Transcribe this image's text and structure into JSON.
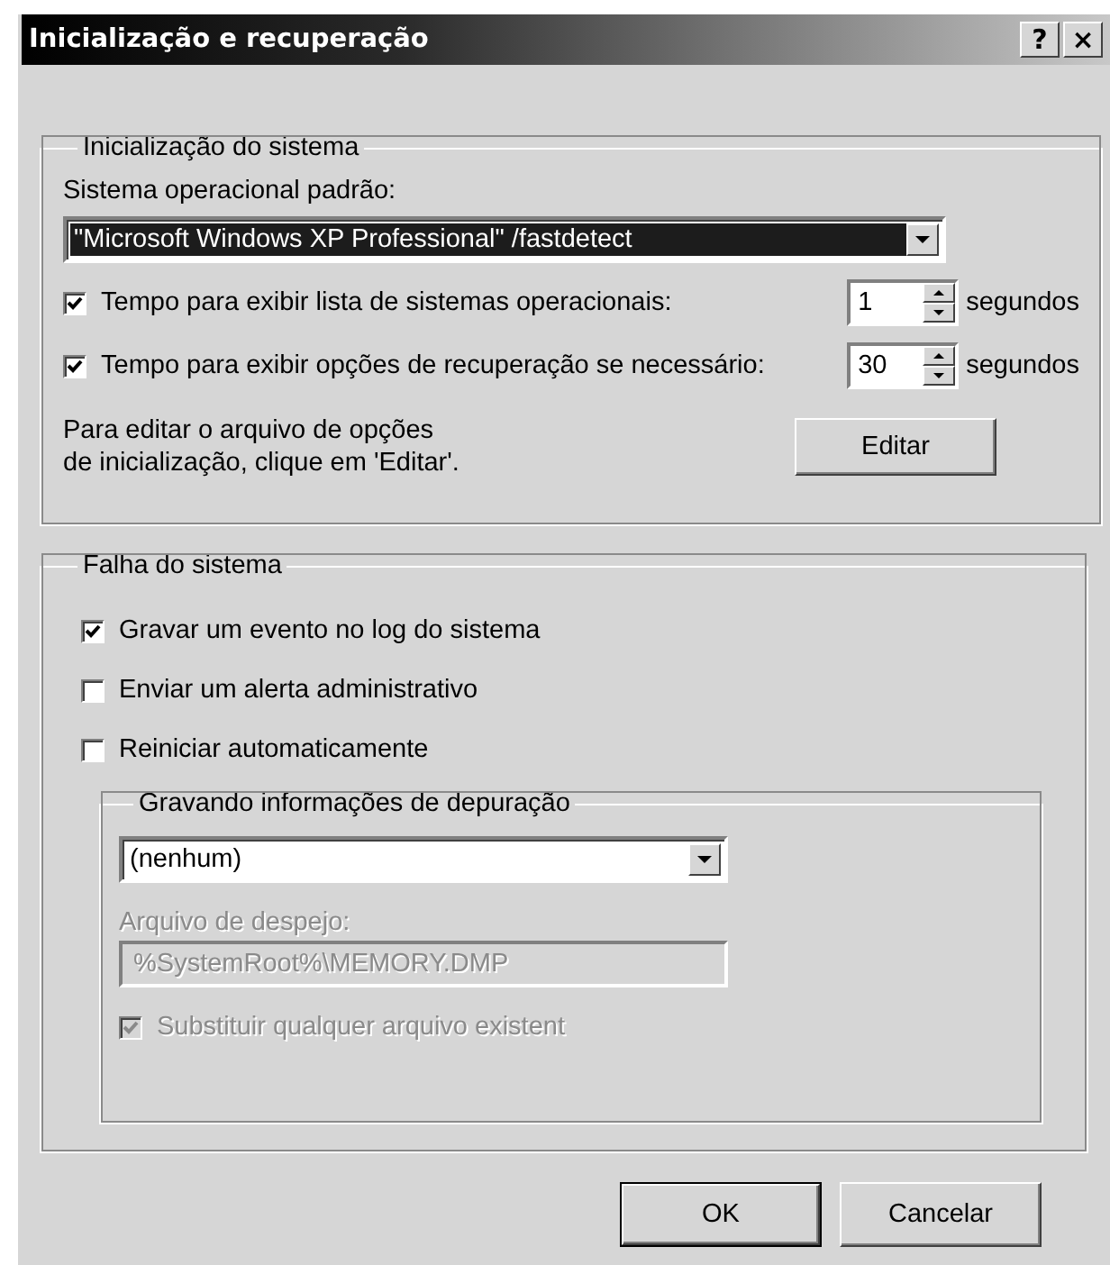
{
  "window": {
    "title": "Inicialização e recuperação",
    "help_button": "?",
    "close_button": "×"
  },
  "startup": {
    "legend": "Inicialização do sistema",
    "os_label": "Sistema operacional padrão:",
    "os_select": {
      "value": "\"Microsoft Windows XP Professional\" /fastdetect",
      "highlighted": true
    },
    "timeouts": [
      {
        "label": "Tempo para exibir lista de sistemas operacionais:",
        "checked": true,
        "value": "1",
        "unit": "segundos"
      },
      {
        "label": "Tempo para exibir opções de recuperação se necessário:",
        "checked": true,
        "value": "30",
        "unit": "segundos"
      }
    ],
    "edit_note": "Para editar o arquivo de opções\nde inicialização, clique em 'Editar'.",
    "edit_button": "Editar"
  },
  "failure": {
    "legend": "Falha do sistema",
    "options": [
      {
        "label": "Gravar um evento no log do sistema",
        "checked": true
      },
      {
        "label": "Enviar um alerta administrativo",
        "checked": false
      },
      {
        "label": "Reiniciar automaticamente",
        "checked": false
      }
    ],
    "debug": {
      "legend": "Gravando informações de depuração",
      "type_select": "(nenhum)",
      "dump_label": {
        "text": "Arquivo de despejo:",
        "disabled": true
      },
      "dump_file": {
        "value": "%SystemRoot%\\MEMORY.DMP",
        "disabled": true
      },
      "overwrite": {
        "label": "Substituir qualquer arquivo existent",
        "checked": true,
        "disabled": true
      }
    }
  },
  "buttons": [
    {
      "label": "OK",
      "default": true
    },
    {
      "label": "Cancelar",
      "default": false
    }
  ]
}
